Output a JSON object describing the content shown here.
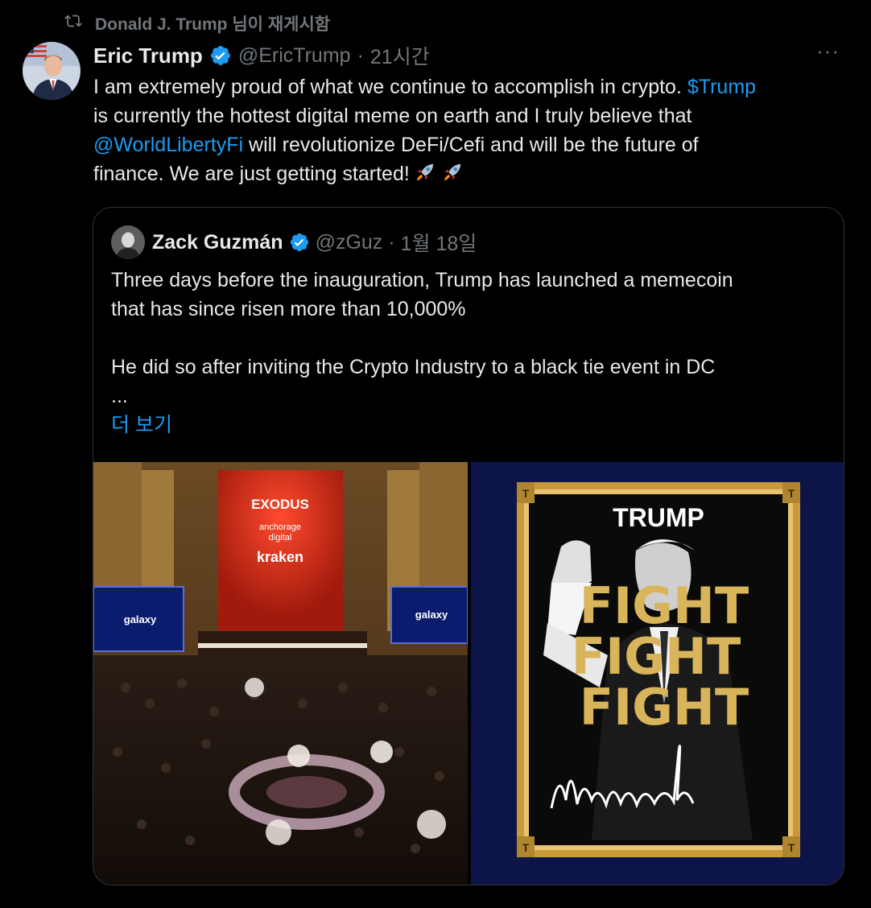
{
  "repost": {
    "text": "Donald J. Trump 님이 재게시함",
    "icon": "repost-icon"
  },
  "tweet": {
    "author_name": "Eric Trump",
    "handle": "@EricTrump",
    "separator": "·",
    "time": "21시간",
    "more_label": "···",
    "text_lines": [
      {
        "before": "I am extremely proud of what we continue to accomplish in crypto. ",
        "link": "$Trump",
        "after": ""
      },
      {
        "before": "is currently the hottest digital meme on earth and I truly believe that",
        "link": "",
        "after": ""
      },
      {
        "before": "",
        "link": "@WorldLibertyFi",
        "after": " will revolutionize DeFi/Cefi and will be the future of"
      },
      {
        "before": "finance. We are just getting started!",
        "link": "",
        "after": ""
      }
    ],
    "emojis": [
      "rocket-emoji",
      "rocket-emoji"
    ]
  },
  "quote": {
    "author_name": "Zack Guzmán",
    "handle": "@zGuz",
    "separator": "·",
    "date": "1월 18일",
    "lines": [
      "Three days before the inauguration, Trump has launched a memecoin",
      "that has since risen more than 10,000%",
      "",
      "He did so after inviting the Crypto Industry to a black tie event in DC",
      "..."
    ],
    "show_more": "더 보기",
    "media": {
      "left_banner": [
        "EXODUS",
        "anchorage",
        "digital",
        "kraken"
      ],
      "left_screens": [
        "galaxy",
        "galaxy"
      ],
      "right_title": "TRUMP",
      "right_words": [
        "FIGHT",
        "FIGHT",
        "FIGHT"
      ],
      "right_frame_letter": "T"
    }
  },
  "colors": {
    "accent": "#1d9bf0",
    "muted": "#71767b",
    "text": "#e7e9ea",
    "border": "#2f3336",
    "gold": "#d4a94a"
  }
}
